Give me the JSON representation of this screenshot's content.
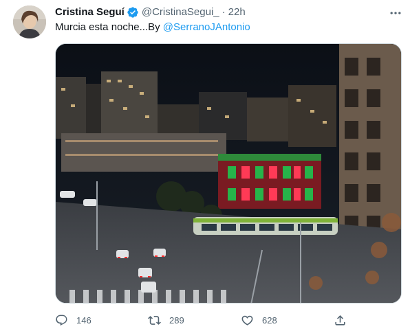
{
  "tweet": {
    "author": {
      "name": "Cristina Seguí",
      "handle": "@CristinaSegui_",
      "verified": true,
      "avatar_icon": "profile-photo"
    },
    "separator": "·",
    "time": "22h",
    "text_prefix": "Murcia esta noche...By ",
    "mention": "@SerranoJAntonio",
    "media": {
      "description_icon": "night-city-photo"
    },
    "actions": {
      "reply": {
        "icon": "reply-icon",
        "count": "146"
      },
      "retweet": {
        "icon": "retweet-icon",
        "count": "289"
      },
      "like": {
        "icon": "heart-icon",
        "count": "628"
      },
      "share": {
        "icon": "share-icon"
      }
    }
  },
  "colors": {
    "text": "#0f1419",
    "secondary": "#536471",
    "accent": "#1d9bf0",
    "border": "#cfd9de"
  }
}
